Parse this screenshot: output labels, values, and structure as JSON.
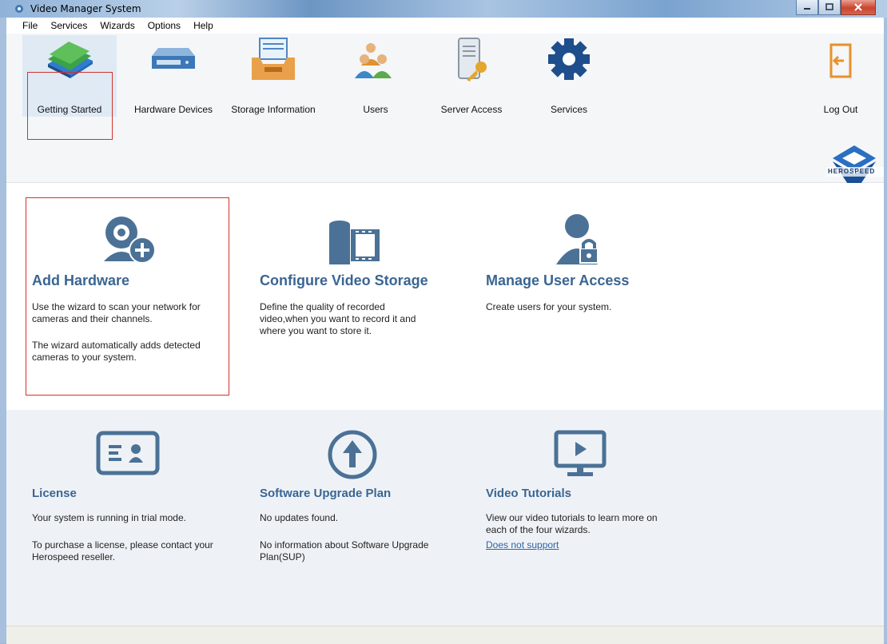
{
  "window": {
    "title": "Video Manager System",
    "controls": [
      "minimize",
      "maximize",
      "close"
    ]
  },
  "menu": [
    "File",
    "Services",
    "Wizards",
    "Options",
    "Help"
  ],
  "toolbar": {
    "getting_started": "Getting Started",
    "hardware_devices": "Hardware Devices",
    "storage_information": "Storage Information",
    "users": "Users",
    "server_access": "Server Access",
    "services": "Services",
    "log_out": "Log Out",
    "logo_text": "HEROSPEED"
  },
  "cards": {
    "add_hardware": {
      "title": "Add Hardware",
      "text1": "Use the wizard to scan your network for cameras and their channels.",
      "text2": "The wizard automatically adds detected cameras to your system."
    },
    "configure_storage": {
      "title": "Configure Video Storage",
      "text1": "Define the quality of recorded video,when you want to record it and where you want to store it."
    },
    "manage_users": {
      "title": "Manage User Access",
      "text1": "Create users for your system."
    },
    "license": {
      "title": "License",
      "text1": "Your system is running in trial mode.",
      "text2": "To purchase a license, please contact your Herospeed reseller."
    },
    "upgrade": {
      "title": "Software Upgrade Plan",
      "text1": "No updates found.",
      "text2": "No information about Software Upgrade Plan(SUP)"
    },
    "tutorials": {
      "title": "Video Tutorials",
      "text1": "View our video tutorials to learn more on each of the four wizards.",
      "link": "Does not support"
    }
  },
  "colors": {
    "accent": "#3a6593",
    "icon": "#4b7196",
    "highlight_border": "#d2322d",
    "link": "#2f63a8"
  }
}
